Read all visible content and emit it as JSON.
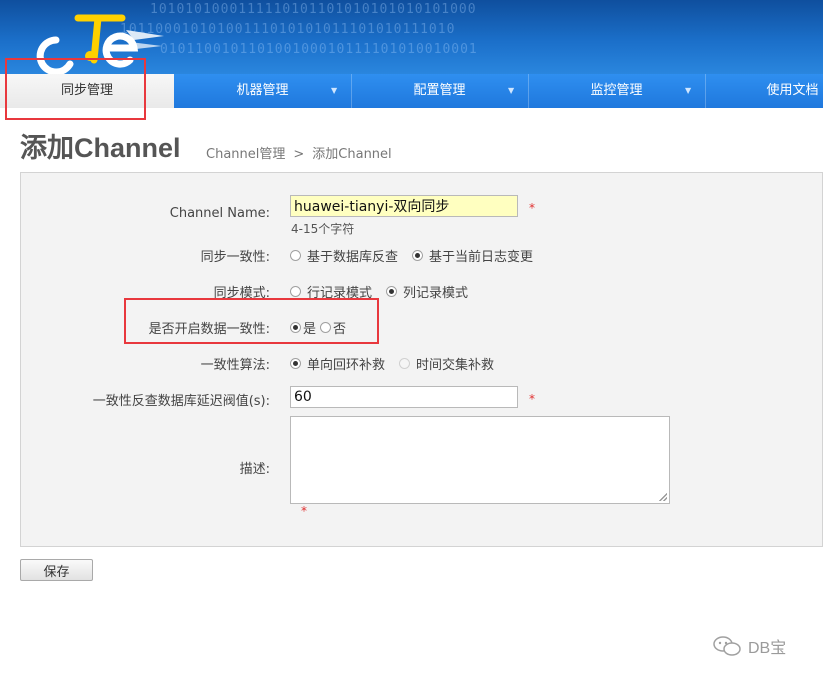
{
  "header": {
    "binary_lines": [
      "1010101000111110101101010101010101000",
      "10110001010100111010101011101010111010",
      "010110010110100100010111101010010001"
    ]
  },
  "nav": {
    "items": [
      {
        "label": "同步管理",
        "active": true
      },
      {
        "label": "机器管理",
        "active": false
      },
      {
        "label": "配置管理",
        "active": false
      },
      {
        "label": "监控管理",
        "active": false
      },
      {
        "label": "使用文档",
        "active": false
      }
    ],
    "arrow": "▼"
  },
  "page": {
    "title": "添加Channel",
    "breadcrumb": [
      "Channel管理",
      ">",
      "添加Channel"
    ]
  },
  "form": {
    "channel_name": {
      "label": "Channel Name:",
      "value": "huawei-tianyi-双向同步",
      "hint": "4-15个字符",
      "required_mark": "*"
    },
    "sync_consistency": {
      "label": "同步一致性:",
      "options": [
        "基于数据库反查",
        "基于当前日志变更"
      ],
      "selected": 1
    },
    "sync_mode": {
      "label": "同步模式:",
      "options": [
        "行记录模式",
        "列记录模式"
      ],
      "selected": 1
    },
    "enable_consistency": {
      "label": "是否开启数据一致性:",
      "options": [
        "是",
        "否"
      ],
      "selected": 0
    },
    "consistency_algorithm": {
      "label": "一致性算法:",
      "options": [
        "单向回环补救",
        "时间交集补救"
      ],
      "selected": 0
    },
    "delay_threshold": {
      "label": "一致性反查数据库延迟阀值(s):",
      "value": "60",
      "required_mark": "*"
    },
    "description": {
      "label": "描述:",
      "value": "",
      "required_mark": "*"
    }
  },
  "actions": {
    "save_label": "保存"
  },
  "watermark": {
    "text": "DB宝"
  },
  "colors": {
    "header_blue": "#1b6fc9",
    "nav_blue": "#2a86e6",
    "highlight_red": "#e8383d",
    "input_highlight": "#ffffc0"
  }
}
